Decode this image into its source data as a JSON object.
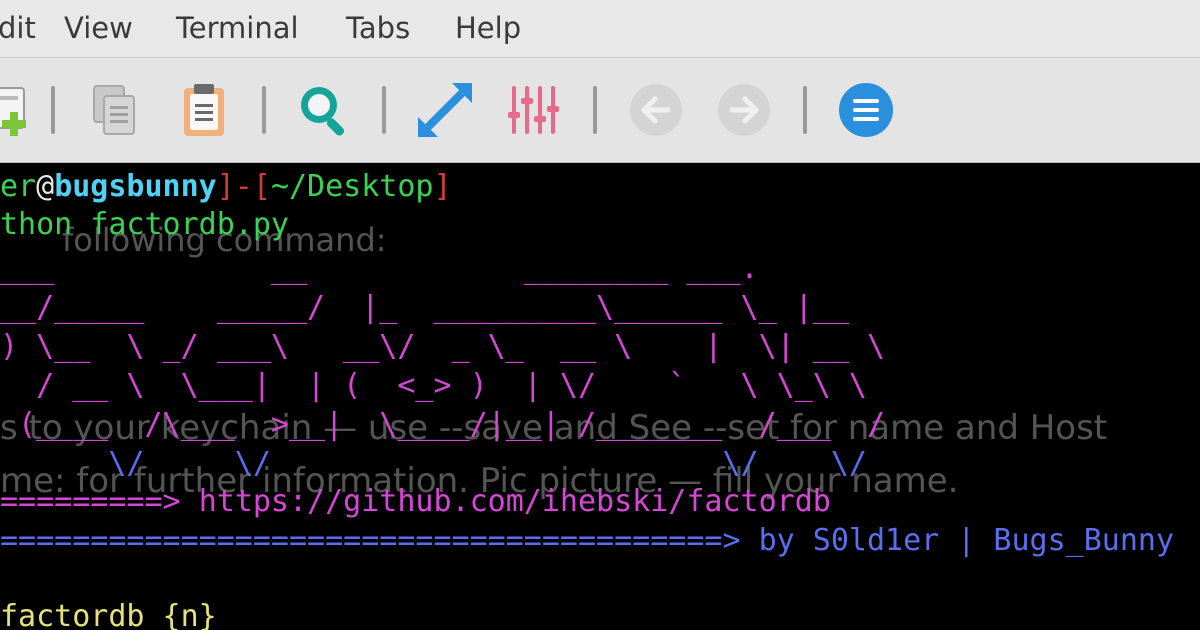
{
  "menu": {
    "items": [
      "dit",
      "View",
      "Terminal",
      "Tabs",
      "Help"
    ]
  },
  "toolbar": {
    "icons": [
      "new-tab-icon",
      "copy-icon",
      "paste-icon",
      "search-icon",
      "fullscreen-icon",
      "preferences-icon",
      "back-icon",
      "forward-icon",
      "menu-icon"
    ]
  },
  "colors": {
    "prompt_green": "#39d353",
    "prompt_red": "#d23a3a",
    "host_cyan": "#4fd2f5",
    "banner_magenta": "#d846d8",
    "banner_blue": "#5b6ef2",
    "usage_yellow": "#e6e276"
  },
  "terminal": {
    "prompt": {
      "user": "er",
      "at": "@",
      "host": "bugsbunny",
      "bracket_sep": "]-[",
      "path": "~/Desktop",
      "bracket_close": "]"
    },
    "command": "thon factordb.py",
    "banner": [
      "___            __            ________ ___.",
      "__/_____    _____/  |_  _________\\______ \\_ |__",
      ") \\__  \\ _/ ___\\   __\\/  _ \\_  __ \\    |  \\| __ \\",
      "  / __ \\  \\___|  | (  <_> )  | \\/    `   \\ \\_\\ \\",
      " (____  /\\___  >__|  \\____/|__| /_______  /___  /",
      "      \\/     \\/                         \\/    \\/"
    ],
    "link_arrow": "=========> ",
    "link_url": "https://github.com/ihebski/factordb",
    "credit_arrow": "========================================> ",
    "credit_text": "by S0ld1er | Bugs_Bunny",
    "usage": "factordb {n}"
  },
  "ghost_text": {
    "line1": "following command:",
    "line2": "s to your keychain — use --save and See --set for name and Host",
    "line3": "me: for further information. Pic picture — fill your name."
  }
}
